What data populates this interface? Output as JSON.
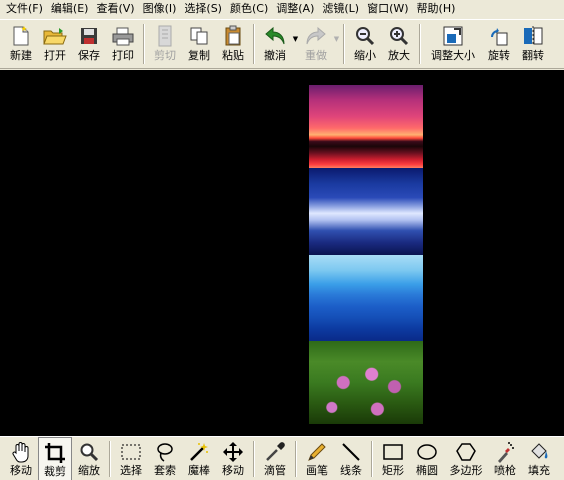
{
  "menu": [
    {
      "label": "文件(F)"
    },
    {
      "label": "编辑(E)"
    },
    {
      "label": "查看(V)"
    },
    {
      "label": "图像(I)"
    },
    {
      "label": "选择(S)"
    },
    {
      "label": "颜色(C)"
    },
    {
      "label": "调整(A)"
    },
    {
      "label": "滤镜(L)"
    },
    {
      "label": "窗口(W)"
    },
    {
      "label": "帮助(H)"
    }
  ],
  "toolbar": {
    "new": "新建",
    "open": "打开",
    "save": "保存",
    "print": "打印",
    "cut": "剪切",
    "copy": "复制",
    "paste": "粘贴",
    "undo": "撤消",
    "redo": "重做",
    "zoom_out": "缩小",
    "zoom_in": "放大",
    "resize": "调整大小",
    "rotate": "旋转",
    "flip": "翻转"
  },
  "tools": {
    "move": "移动",
    "crop": "裁剪",
    "zoom": "缩放",
    "select": "选择",
    "lasso": "套索",
    "magic_wand": "魔棒",
    "move_selection": "移动",
    "eyedropper": "滴管",
    "pencil": "画笔",
    "line": "线条",
    "rectangle": "矩形",
    "ellipse": "椭圆",
    "polygon": "多边形",
    "spray": "喷枪",
    "fill": "填充"
  },
  "colors": {
    "canvas_bg": "#000000",
    "ui_bg": "#ece9d8",
    "disabled_text": "#a0a0a0"
  }
}
